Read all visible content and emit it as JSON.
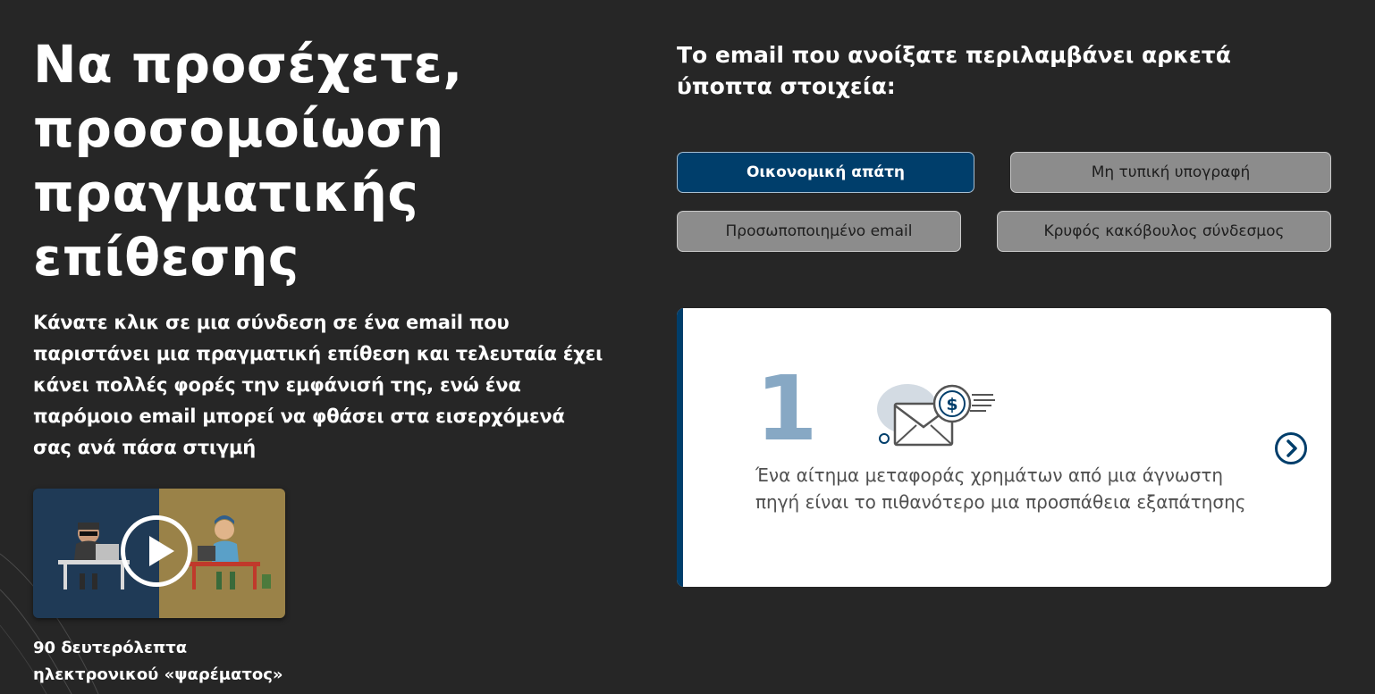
{
  "left": {
    "headline": "Να προσέχετε, προσομοίωση πραγματικής επίθεσης",
    "subtext": "Κάνατε κλικ σε μια σύνδεση σε ένα email που παριστάνει μια πραγματική επίθεση και τελευταία έχει κάνει πολλές φορές την εμφάνισή της, ενώ ένα παρόμοιο email μπορεί να φθάσει στα εισερχόμενά σας ανά πάσα στιγμή",
    "video": {
      "icon": "play-icon",
      "caption_line1": "90 δευτερόλεπτα",
      "caption_line2": "ηλεκτρονικού «ψαρέματος»"
    }
  },
  "right": {
    "heading": "Το email που ανοίξατε περιλαμβάνει αρκετά ύποπτα στοιχεία:",
    "tags": [
      {
        "label": "Οικονομική απάτη",
        "active": true
      },
      {
        "label": "Μη τυπική υπογραφή",
        "active": false
      },
      {
        "label": "Προσωποποιημένο email",
        "active": false
      },
      {
        "label": "Κρυφός κακόβουλος σύνδεσμος",
        "active": false
      }
    ],
    "card": {
      "number": "1",
      "illustration": "email-money-icon",
      "text": "Ένα αίτημα μεταφοράς χρημάτων από μια άγνωστη πηγή είναι το πιθανότερο μια προσπάθεια εξαπάτησης",
      "next_icon": "chevron-right-circle-icon"
    }
  },
  "colors": {
    "background": "#262626",
    "primary": "#003e6b",
    "tag_inactive": "#8c8c8c",
    "number_accent": "#87a8c4",
    "video_left_panel": "#1f3a56",
    "video_right_panel": "#9a8248"
  }
}
